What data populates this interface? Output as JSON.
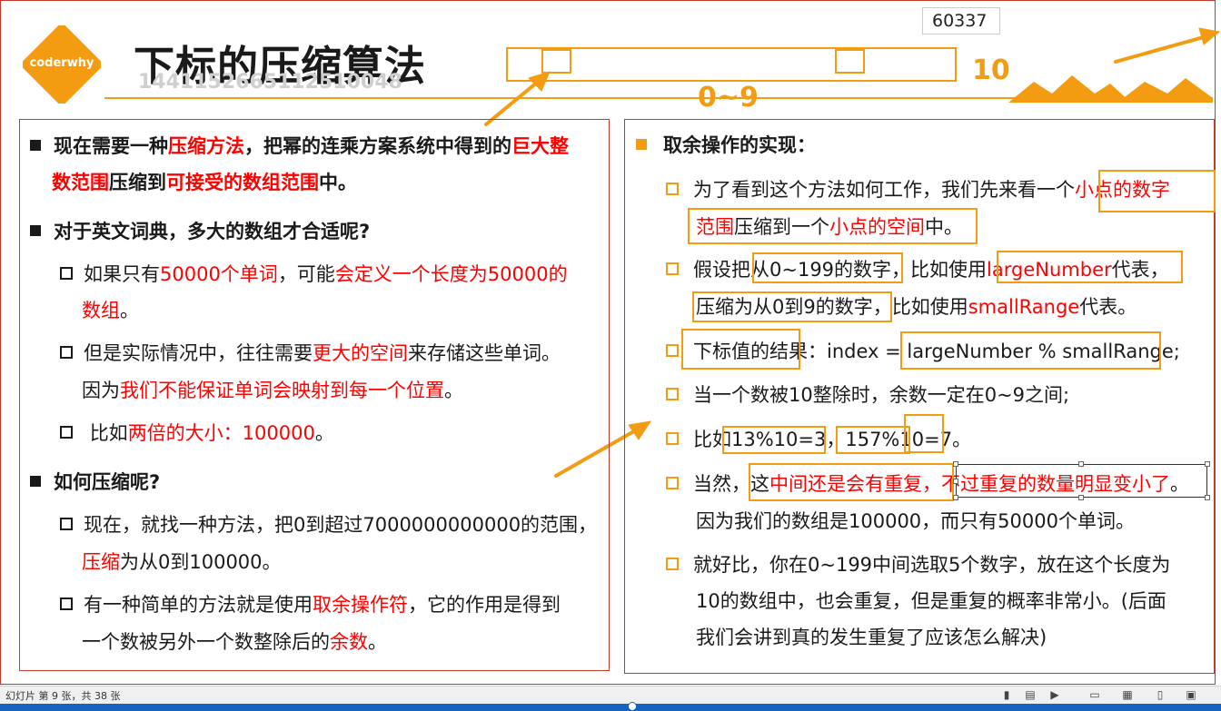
{
  "slide": {
    "logo_text": "coderwhy",
    "title": "下标的压缩算法",
    "watermark": "1441152665112510048",
    "counter": "60337",
    "label_10": "10",
    "label_0_9": "0~9"
  },
  "left_panel": {
    "b1_a": "现在需要一种",
    "b1_b": "压缩方法",
    "b1_c": "，把幂的连乘方案系统中得到的",
    "b1_d": "巨大整",
    "b1_e": "数范围",
    "b1_f": "压缩到",
    "b1_g": "可接受的数组范围",
    "b1_h": "中。",
    "b2": "对于英文词典，多大的数组才合适呢?",
    "s1_a": "如果只有",
    "s1_b": "50000个单词",
    "s1_c": "，可能",
    "s1_d": "会定义一个长度为50000的",
    "s1_e": "数组",
    "s1_f": "。",
    "s2_a": "但是实际情况中，往往需要",
    "s2_b": "更大的空间",
    "s2_c": "来存储这些单词。",
    "s2_d": "因为",
    "s2_e": "我们不能保证单词会映射到每一个位置",
    "s2_f": "。",
    "s3_a": "比如",
    "s3_b": "两倍的大小：100000",
    "s3_c": "。",
    "b3": "如何压缩呢?",
    "s4_a": "现在，就找一种方法，把0到超过7000000000000的范围，",
    "s4_b": "压缩",
    "s4_c": "为从0到100000。",
    "s5_a": "有一种简单的方法就是使用",
    "s5_b": "取余操作符",
    "s5_c": "，它的作用是得到",
    "s5_d": "一个数被另外一个数整除后的",
    "s5_e": "余数",
    "s5_f": "。"
  },
  "right_panel": {
    "heading": "取余操作的实现：",
    "r1_a": "为了看到这个方法如何工作，我们先来看一个",
    "r1_b": "小点的数字",
    "r1_c": "范围",
    "r1_d": "压缩到一个",
    "r1_e": "小点的空间",
    "r1_f": "中。",
    "r2_a": "假设把从0~199的数字，比如使用",
    "r2_b": "largeNumber",
    "r2_c": "代表，",
    "r2_d": "压缩为从0到9的数字，比如使用",
    "r2_e": "smallRange",
    "r2_f": "代表。",
    "r3_a": "下标值的结果：index = largeNumber % smallRange;",
    "r4": "当一个数被10整除时，余数一定在0~9之间;",
    "r5_a": "比如",
    "r5_b": "13%10=3，157%10=7",
    "r5_c": "。",
    "r6_a": "当然，这",
    "r6_b": "中间还是会有重复，",
    "r6_c": "不过重复的数量明显变小了",
    "r6_d": "。",
    "r6_e": "因为我们的数组是100000，而只有50000个单词。",
    "r7_a": "就好比，你在0~199中间选取5个数字，放在这个长度为",
    "r7_b": "10的数组中，也会重复，但是重复的概率非常小。(后面",
    "r7_c": "我们会讲到真的发生重复了应该怎么解决)"
  },
  "statusbar": {
    "slide_info": "幻灯片 第 9 张，共 38 张",
    "progress_fraction": 0.52
  },
  "colors": {
    "accent": "#f39c12",
    "highlight": "#ff0000",
    "border": "#c0392b",
    "progress": "#1565c0"
  },
  "icons": [
    "notes-icon",
    "reading-view-icon",
    "slideshow-icon",
    "normal-view-icon",
    "slide-sorter-icon",
    "reading-icon",
    "fit-icon"
  ]
}
